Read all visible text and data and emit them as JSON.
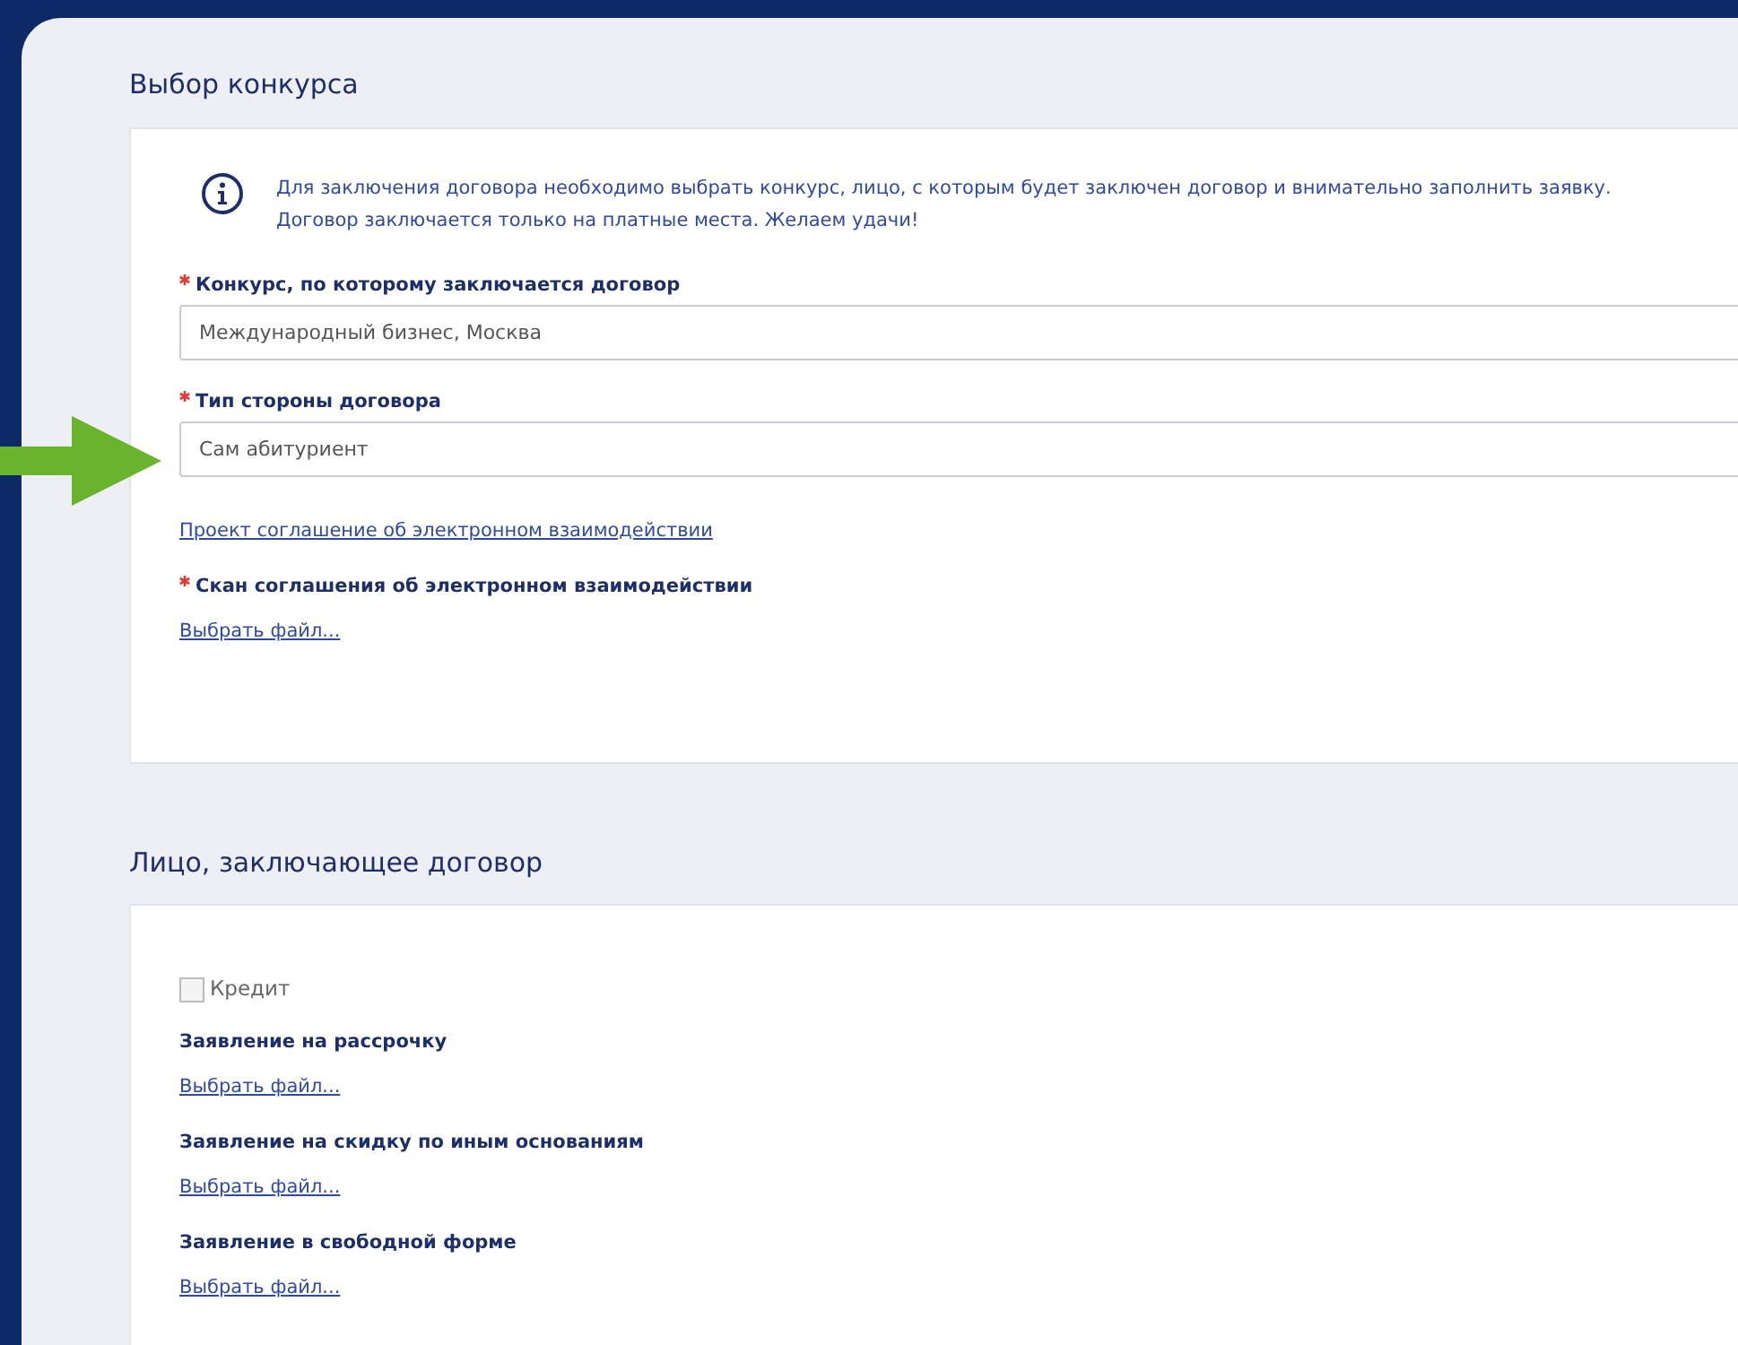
{
  "sections": [
    {
      "title": "Выбор конкурса",
      "info": [
        "Для заключения договора необходимо выбрать конкурс, лицо, с которым будет заключен договор и внимательно заполнить заявку.",
        "Договор заключается только на платные места. Желаем удачи!"
      ],
      "fields": [
        {
          "kind": "select",
          "required": true,
          "label": "Конкурс, по которому заключается договор",
          "value": "Международный бизнес, Москва"
        },
        {
          "kind": "select",
          "required": true,
          "label": "Тип стороны договора",
          "value": "Сам абитуриент"
        },
        {
          "kind": "link",
          "text": "Проект соглашение об электронном взаимодействии"
        },
        {
          "kind": "file",
          "required": true,
          "label": "Скан соглашения об электронном взаимодействии",
          "link": "Выбрать файл..."
        }
      ]
    },
    {
      "title": "Лицо, заключающее договор",
      "fields": [
        {
          "kind": "checkbox",
          "label": "Кредит",
          "checked": false
        },
        {
          "kind": "file",
          "required": false,
          "label": "Заявление на рассрочку",
          "link": "Выбрать файл..."
        },
        {
          "kind": "file",
          "required": false,
          "label": "Заявление на скидку по иным основаниям",
          "link": "Выбрать файл..."
        },
        {
          "kind": "file",
          "required": false,
          "label": "Заявление в свободной форме",
          "link": "Выбрать файл..."
        }
      ]
    }
  ]
}
